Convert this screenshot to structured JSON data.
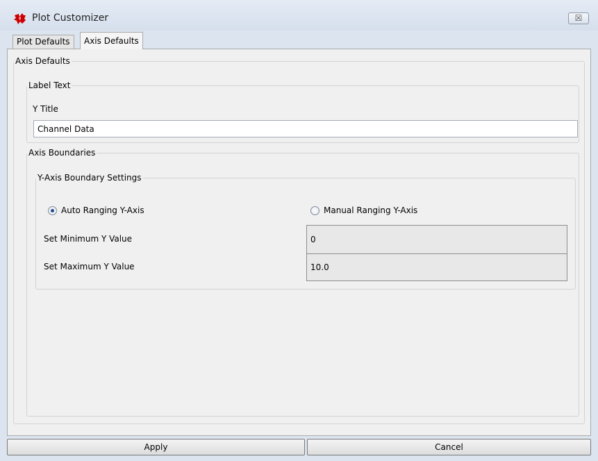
{
  "window": {
    "title": "Plot Customizer",
    "close_glyph": "☒",
    "icon": "ti-logo-icon",
    "accent_color": "#cc0000"
  },
  "tabs": [
    {
      "label": "Plot Defaults",
      "active": false
    },
    {
      "label": "Axis Defaults",
      "active": true
    }
  ],
  "axis_defaults": {
    "group_title": "Axis Defaults",
    "label_text": {
      "group_title": "Label Text",
      "y_title_label": "Y Title",
      "y_title_value": "Channel Data"
    },
    "axis_boundaries": {
      "group_title": "Axis Boundaries",
      "y_axis_settings": {
        "group_title": "Y-Axis Boundary Settings",
        "auto_ranging_label": "Auto Ranging Y-Axis",
        "auto_ranging_selected": true,
        "manual_ranging_label": "Manual Ranging Y-Axis",
        "manual_ranging_selected": false,
        "min_label": "Set Minimum Y Value",
        "min_value": "0",
        "max_label": "Set Maximum Y Value",
        "max_value": "10.0"
      }
    }
  },
  "buttons": {
    "apply": "Apply",
    "cancel": "Cancel"
  }
}
